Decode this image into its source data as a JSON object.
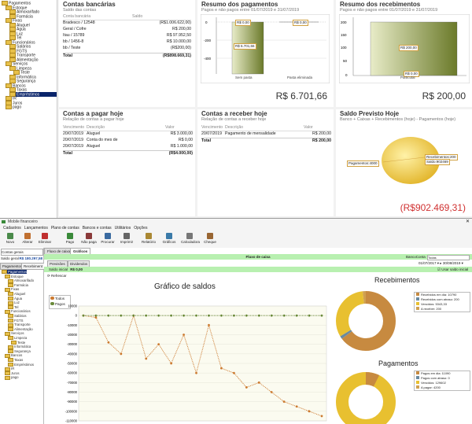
{
  "top": {
    "tree": [
      {
        "label": "Pagamentos",
        "indent": 0
      },
      {
        "label": "Estoque",
        "indent": 1
      },
      {
        "label": "Almoxarifado",
        "indent": 2
      },
      {
        "label": "Farmácia",
        "indent": 2
      },
      {
        "label": "Fixas",
        "indent": 1
      },
      {
        "label": "Aluguel",
        "indent": 2
      },
      {
        "label": "Água",
        "indent": 2
      },
      {
        "label": "Luz",
        "indent": 2
      },
      {
        "label": "Tel",
        "indent": 2
      },
      {
        "label": "Funcionários",
        "indent": 1
      },
      {
        "label": "Salários",
        "indent": 2
      },
      {
        "label": "FGTS",
        "indent": 2
      },
      {
        "label": "Transporte",
        "indent": 2
      },
      {
        "label": "Alimentação",
        "indent": 2
      },
      {
        "label": "Serviços",
        "indent": 1
      },
      {
        "label": "Limpeza",
        "indent": 2
      },
      {
        "label": "Teste",
        "indent": 3
      },
      {
        "label": "Informática",
        "indent": 2
      },
      {
        "label": "Segurança",
        "indent": 2
      },
      {
        "label": "Bancos",
        "indent": 1
      },
      {
        "label": "Taxas",
        "indent": 2
      },
      {
        "label": "Empréstimos",
        "indent": 2,
        "selected": true
      },
      {
        "label": "IR",
        "indent": 1
      },
      {
        "label": "Juros",
        "indent": 1
      },
      {
        "label": "pago",
        "indent": 1
      }
    ],
    "contas_bancarias": {
      "title": "Contas bancárias",
      "subtitle": "Saldo das contas",
      "col1": "Conta bancária",
      "col2": "Saldo",
      "rows": [
        {
          "name": "Bradesco / 12548",
          "value": "(R$1.006.622,00)"
        },
        {
          "name": "Geral / Cofre",
          "value": "R$ 200,00"
        },
        {
          "name": "Itau / 15789",
          "value": "R$ 97.952,50"
        },
        {
          "name": "bb / 1456-8",
          "value": "R$ 10.000,00"
        },
        {
          "name": "bb / Teste",
          "value": "(R$200,00)"
        }
      ],
      "total_label": "Total",
      "total_value": "(R$898.669,31)"
    },
    "resumo_pagamentos": {
      "title": "Resumo dos pagamentos",
      "subtitle": "Pagos e não pagos entre 01/07/2019 e 31/07/2019",
      "y_ticks": [
        "0",
        "-200",
        "-400"
      ],
      "bars": [
        {
          "name": "Sem pasta",
          "label1": "R$ 0,00",
          "label2": "R$ 6.701,66"
        },
        {
          "name": "Pasta eliminada",
          "label1": "R$ 0,00"
        }
      ],
      "total": "R$ 6.701,66"
    },
    "resumo_recebimentos": {
      "title": "Resumo dos recebimentos",
      "subtitle": "Pagos e não pagos entre 01/07/2019 e 31/07/2019",
      "y_ticks": [
        "200",
        "150",
        "100",
        "50",
        "0"
      ],
      "bar_label": "R$ 200,00",
      "bar_label_low": "R$ 0,00",
      "x_label": "Particular",
      "total": "R$ 200,00"
    },
    "contas_pagar": {
      "title": "Contas a pagar hoje",
      "subtitle": "Relação de contas a pagar hoje",
      "col1": "Vencimento",
      "col2": "Descrição",
      "col3": "Valor",
      "rows": [
        {
          "date": "20/07/2019",
          "desc": "Aluguel",
          "value": "R$ 3.000,00"
        },
        {
          "date": "20/07/2019",
          "desc": "Conta do mes de",
          "value": "R$ 0,00"
        },
        {
          "date": "20/07/2019",
          "desc": "Aluguel",
          "value": "R$ 1.000,00"
        }
      ],
      "total_label": "Total",
      "total_value": "(R$4.000,00)"
    },
    "contas_receber": {
      "title": "Contas a receber hoje",
      "subtitle": "Relação de contas a receber hoje",
      "col1": "Vencimento",
      "col2": "Descrição",
      "col3": "Valor",
      "rows": [
        {
          "date": "20/07/2019",
          "desc": "Pagamento de mensalidade",
          "value": "R$ 200,00"
        }
      ],
      "total_label": "Total",
      "total_value": "R$ 200,00"
    },
    "saldo_previsto": {
      "title": "Saldo Previsto Hoje",
      "subtitle": "Banco + Caixas + Recebimentos (hoje) - Pagamentos (hoje)",
      "labels": [
        "Pagamentos:4000",
        "Recebimentos:200",
        "Saldo:902469"
      ],
      "total": "(R$902.469,31)"
    }
  },
  "window": {
    "title": "Mobile financeiro",
    "menu": [
      "Cadastros",
      "Lançamentos",
      "Plano de contas",
      "Bancos e contas",
      "Utilitários",
      "Opções"
    ],
    "toolbar": [
      "Novo",
      "Alterar",
      "Eliminar",
      "Pago",
      "Não paga",
      "Procurar",
      "Imprimir",
      "Relatório",
      "Gráficos",
      "Calculadora",
      "Cheque"
    ],
    "search_placeholder": "Contas gerais",
    "side_saldo": "Saldo geral",
    "side_saldo_value": "R$ 180.297,58",
    "side_tabs": [
      "Pagamentos",
      "Recebiment"
    ],
    "side_tree": [
      "Pagamentos",
      "Estoque",
      "Almoxarifado",
      "Farmácia",
      "Fixas",
      "Aluguel",
      "Água",
      "Luz",
      "Tel",
      "Funcionários",
      "Salários",
      "FGTS",
      "Transporte",
      "Alimentação",
      "Serviços",
      "Limpeza",
      "Teste",
      "Informática",
      "Segurança",
      "Bancos",
      "Taxas",
      "Empréstimos",
      "IR",
      "Juros",
      "pago"
    ],
    "tabs": [
      "Fluxo de caixa",
      "Gráficos"
    ],
    "subtabs": [
      "Previsões",
      "Dividendos"
    ],
    "flow_title": "Fluxo de caixa",
    "banco_label": "BancoConta",
    "banco_value": "Todas",
    "date_from": "01/07/2017",
    "date_to": "30/08/2019",
    "saldo_inicial_label": "Saldo inicial",
    "saldo_inicial_value": "R$ 0,00",
    "refresh_label": "Refrescar",
    "chk_label": "Usar saldo inicial",
    "chart_title": "Gráfico de saldos",
    "legend": [
      "Todos",
      "Pagos"
    ],
    "rec_title": "Recebimentos",
    "rec_legend": [
      "Recebidos em dia: 10790",
      "Recebidos com atraso: 200",
      "Vencidos: 5343,33",
      "A receber: 200"
    ],
    "pag_title": "Pagamentos",
    "pag_legend": [
      "Pagos em dia: 11090",
      "Pagos com atraso: 0",
      "Vencidos: 129602",
      "A pagar: 4200"
    ],
    "y_ticks": [
      "10000",
      "0",
      "-10000",
      "-20000",
      "-30000",
      "-40000",
      "-50000",
      "-60000",
      "-70000",
      "-80000",
      "-90000",
      "-100000",
      "-110000"
    ]
  },
  "chart_data": [
    {
      "type": "bar",
      "title": "Resumo dos pagamentos",
      "categories": [
        "Sem pasta",
        "Pasta eliminada"
      ],
      "values": [
        -6701.66,
        0
      ],
      "ylim": [
        -480,
        20
      ]
    },
    {
      "type": "bar",
      "title": "Resumo dos recebimentos",
      "categories": [
        "Particular"
      ],
      "values": [
        200
      ],
      "ylim": [
        0,
        220
      ]
    },
    {
      "type": "pie",
      "title": "Saldo Previsto Hoje",
      "categories": [
        "Pagamentos",
        "Recebimentos",
        "Saldo"
      ],
      "values": [
        4000,
        200,
        902469
      ]
    },
    {
      "type": "line",
      "title": "Gráfico de saldos",
      "series": [
        {
          "name": "Todos",
          "values": [
            0,
            -2000,
            -28000,
            -40000,
            0,
            -45000,
            -30000,
            -50000,
            -20000,
            -60000,
            -10000,
            -55000,
            -60000,
            -75000,
            -70000,
            -80000,
            -90000,
            -95000,
            -100000,
            -105000
          ]
        },
        {
          "name": "Pagos",
          "values": [
            0,
            0,
            0,
            0,
            0,
            0,
            0,
            0,
            0,
            0,
            0,
            0,
            0,
            0,
            0,
            0,
            0,
            0,
            0,
            0
          ]
        }
      ],
      "ylim": [
        -110000,
        10000
      ]
    },
    {
      "type": "pie",
      "title": "Recebimentos",
      "categories": [
        "Recebidos em dia",
        "Recebidos com atraso",
        "Vencidos",
        "A receber"
      ],
      "values": [
        10790,
        200,
        5343.33,
        200
      ]
    },
    {
      "type": "pie",
      "title": "Pagamentos",
      "categories": [
        "Pagos em dia",
        "Pagos com atraso",
        "Vencidos",
        "A pagar"
      ],
      "values": [
        11090,
        0,
        129602,
        4200
      ]
    }
  ]
}
